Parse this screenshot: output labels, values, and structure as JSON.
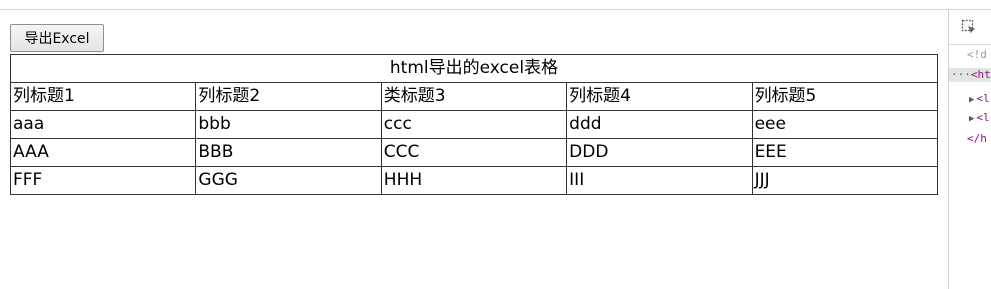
{
  "toolbar": {
    "export_label": "导出Excel"
  },
  "table": {
    "caption": "html导出的excel表格",
    "headers": [
      "列标题1",
      "列标题2",
      "类标题3",
      "列标题4",
      "列标题5"
    ],
    "rows": [
      [
        "aaa",
        "bbb",
        "ccc",
        "ddd",
        "eee"
      ],
      [
        "AAA",
        "BBB",
        "CCC",
        "DDD",
        "EEE"
      ],
      [
        "FFF",
        "GGG",
        "HHH",
        "III",
        "JJJ"
      ]
    ]
  },
  "devtools": {
    "inspect_icon": "inspect-element-icon",
    "lines": [
      "<!d",
      "<htm",
      "<l",
      "<l",
      "</h"
    ],
    "expand_icon": "triangle-right-icon",
    "colors": {
      "tag": "#881280",
      "doctype": "#9a9a9a",
      "selected_bg": "#e4e4e4"
    }
  }
}
